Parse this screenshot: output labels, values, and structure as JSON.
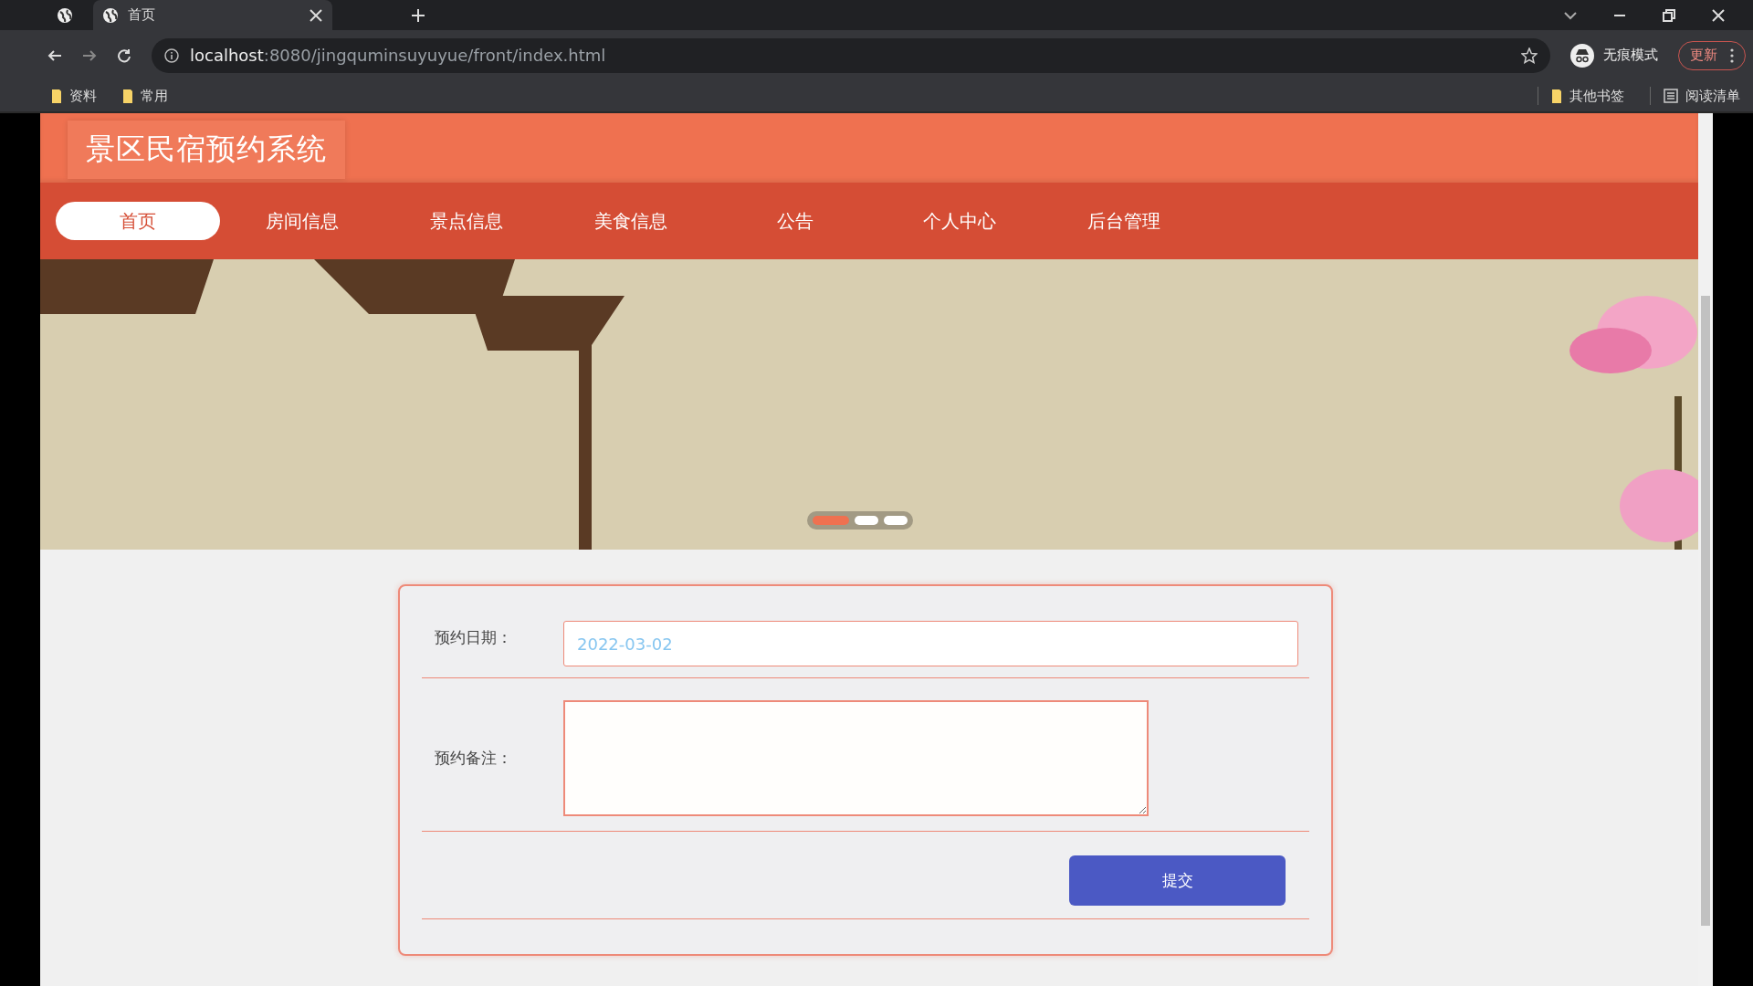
{
  "browser": {
    "tab": {
      "title": "首页"
    },
    "url": {
      "host": "localhost",
      "path": ":8080/jingquminsuyuyue/front/index.html"
    },
    "profile": "无痕模式",
    "update_button": "更新",
    "bookmarks": [
      "资料",
      "常用"
    ],
    "other_bookmarks": "其他书签",
    "reading_list": "阅读清单"
  },
  "site": {
    "title": "景区民宿预约系统"
  },
  "nav": [
    {
      "label": "首页",
      "selected": true
    },
    {
      "label": "房间信息",
      "selected": false
    },
    {
      "label": "景点信息",
      "selected": false
    },
    {
      "label": "美食信息",
      "selected": false
    },
    {
      "label": "公告",
      "selected": false
    },
    {
      "label": "个人中心",
      "selected": false
    },
    {
      "label": "后台管理",
      "selected": false
    }
  ],
  "carousel": {
    "dots": [
      {
        "selected": true
      },
      {
        "selected": false
      },
      {
        "selected": false
      }
    ]
  },
  "form": {
    "fields": [
      {
        "kind": "input",
        "label": "预约日期：",
        "value": "2022-03-02"
      },
      {
        "kind": "textarea",
        "label": "预约备注："
      }
    ],
    "submit": "提交"
  }
}
